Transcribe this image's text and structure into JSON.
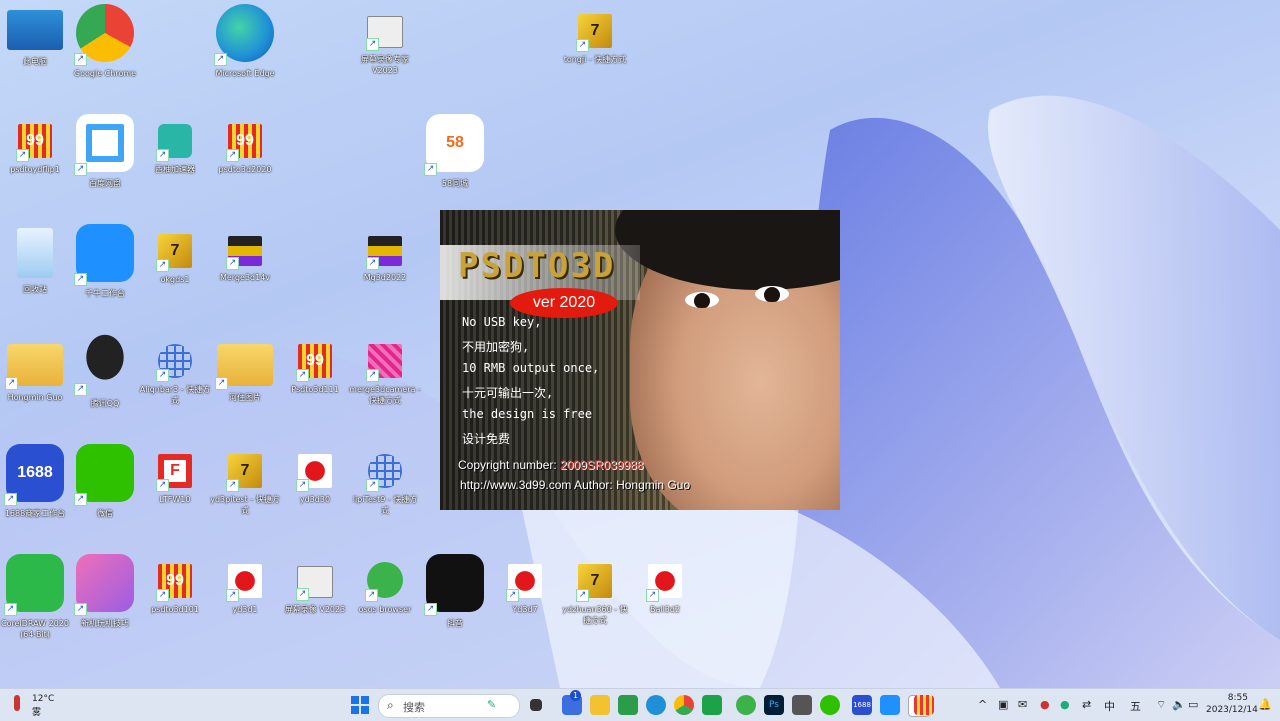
{
  "desktop": {
    "icons": [
      {
        "label": "此电脑",
        "icon": "pc-icon"
      },
      {
        "label": "Google Chrome",
        "icon": "chrome-icon"
      },
      {
        "label": "Microsoft Edge",
        "icon": "edge-icon"
      },
      {
        "label": "屏幕录像专家 V2023",
        "icon": "screen-recorder-icon"
      },
      {
        "label": "tongji - 快捷方式",
        "icon": "seven-icon"
      },
      {
        "label": "psdtoydflip1",
        "icon": "nine-nine-icon"
      },
      {
        "label": "百度网盘",
        "icon": "baidu-netdisk-icon"
      },
      {
        "label": "西柚加速器",
        "icon": "accelerator-icon"
      },
      {
        "label": "psdto3d2020",
        "icon": "nine-nine-icon"
      },
      {
        "label": "58同城",
        "icon": "58-icon"
      },
      {
        "label": "回收站",
        "icon": "recycle-bin-icon"
      },
      {
        "label": "千牛工作台",
        "icon": "qianniu-icon"
      },
      {
        "label": "okgds1",
        "icon": "seven-icon"
      },
      {
        "label": "Merge3d14v",
        "icon": "merge-icon"
      },
      {
        "label": "Mg3d2022",
        "icon": "merge-icon"
      },
      {
        "label": "Hongmin Guo",
        "icon": "user-folder-icon"
      },
      {
        "label": "腾讯QQ",
        "icon": "qq-icon"
      },
      {
        "label": "Alignbar3 - 快捷方式",
        "icon": "grid-globe-icon"
      },
      {
        "label": "河住图片",
        "icon": "zip-folder-icon"
      },
      {
        "label": "Psdto3d111",
        "icon": "nine-nine-icon"
      },
      {
        "label": "merge3dcamera - 快捷方式",
        "icon": "pattern-icon"
      },
      {
        "label": "1688商家工作台",
        "icon": "1688-icon"
      },
      {
        "label": "微信",
        "icon": "wechat-icon"
      },
      {
        "label": "LTFW10",
        "icon": "f-icon"
      },
      {
        "label": "yd3pitest - 快捷方式",
        "icon": "seven-icon"
      },
      {
        "label": "yd3d30",
        "icon": "red-dot-icon"
      },
      {
        "label": "lipiTest9 - 快捷方式",
        "icon": "grid-globe-icon"
      },
      {
        "label": "CorelDRAW 2020 (64-Bit)",
        "icon": "coreldraw-icon"
      },
      {
        "label": "新机玩机技巧",
        "icon": "tips-icon"
      },
      {
        "label": "psdto3d101",
        "icon": "nine-nine-icon"
      },
      {
        "label": "yd3d1",
        "icon": "red-dot-icon"
      },
      {
        "label": "屏幕录像 V2023",
        "icon": "screen-recorder-icon"
      },
      {
        "label": "osos browser",
        "icon": "browser-icon"
      },
      {
        "label": "抖音",
        "icon": "tiktok-icon"
      },
      {
        "label": "Yd3d7",
        "icon": "red-dot-icon"
      },
      {
        "label": "ydzhuan360 - 快捷方式",
        "icon": "seven-icon"
      },
      {
        "label": "Ball3d2",
        "icon": "red-dot-icon"
      }
    ]
  },
  "splash": {
    "title": "PSDTO3D",
    "version": "ver 2020",
    "lines": [
      "No USB key,",
      "不用加密狗,",
      "10 RMB output once,",
      "十元可输出一次,",
      "the design is free",
      "设计免费"
    ],
    "copyright_label": "Copyright number: ",
    "copyright_number": "2009SR039988",
    "url_author": "http://www.3d99.com  Author: Hongmin Guo"
  },
  "taskbar": {
    "weather_temp": "12°C",
    "weather_desc": "雾",
    "search_placeholder": "搜索",
    "ime_mode": "中",
    "ime_extra": "五",
    "time": "8:55",
    "date": "2023/12/14",
    "notification_count": "1",
    "colors": {
      "accent": "#0067c0",
      "start": "#1a73e8"
    }
  }
}
